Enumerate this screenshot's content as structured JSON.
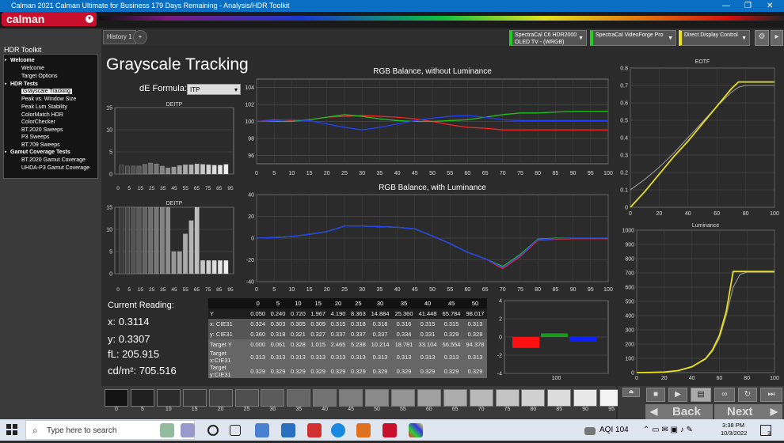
{
  "window": {
    "title": "Calman 2021 Calman Ultimate for Business 179 Days Remaining  - Analysis/HDR Toolkit",
    "minimize": "—",
    "restore": "❐",
    "close": "✕"
  },
  "app": {
    "logo": "calman"
  },
  "sidebar": {
    "title": "HDR Toolkit",
    "items": [
      {
        "label": "Welcome",
        "level": 0
      },
      {
        "label": "Welcome",
        "level": 1
      },
      {
        "label": "Target Options",
        "level": 1
      },
      {
        "label": "HDR Tests",
        "level": 0
      },
      {
        "label": "Grayscale Tracking",
        "level": 1,
        "selected": true
      },
      {
        "label": "Peak vs. Window Size",
        "level": 1
      },
      {
        "label": "Peak Lum Stability",
        "level": 1
      },
      {
        "label": "ColorMatch HDR",
        "level": 1
      },
      {
        "label": "ColorChecker",
        "level": 1
      },
      {
        "label": "BT.2020 Sweeps",
        "level": 1
      },
      {
        "label": "P3 Sweeps",
        "level": 1
      },
      {
        "label": "BT.709 Sweeps",
        "level": 1
      },
      {
        "label": "Gamut Coverage Tests",
        "level": 0
      },
      {
        "label": "BT.2020 Gamut Coverage",
        "level": 1
      },
      {
        "label": "UHDA-P3 Gamut Coverage",
        "level": 1
      }
    ]
  },
  "tabs": {
    "history": "History 1",
    "add": "+"
  },
  "devices": [
    {
      "line1": "SpectraCal C6 HDR2000",
      "line2": "OLED TV - (WRGB)",
      "color": "#22cc22"
    },
    {
      "line1": "SpectraCal VideoForge Pro",
      "line2": "",
      "color": "#22cc22"
    },
    {
      "line1": "Direct Display Control",
      "line2": "",
      "color": "#e8e020"
    }
  ],
  "page": {
    "title": "Grayscale Tracking",
    "de_label": "dE Formula:",
    "de_value": "ITP"
  },
  "readings": {
    "heading": "Current Reading:",
    "x": "x: 0.3114",
    "y": "y: 0.3307",
    "fl": "fL: 205.915",
    "cdm2": "cd/m²: 705.516"
  },
  "table": {
    "headers": [
      "",
      "0",
      "5",
      "10",
      "15",
      "20",
      "25",
      "30",
      "35",
      "40",
      "45",
      "50"
    ],
    "rows": [
      [
        "Y",
        "0.050",
        "0.240",
        "0.720",
        "1.967",
        "4.190",
        "8.363",
        "14.884",
        "25.360",
        "41.448",
        "65.784",
        "98.017"
      ],
      [
        "x: CIE31",
        "0.324",
        "0.303",
        "0.305",
        "0.309",
        "0.315",
        "0.318",
        "0.318",
        "0.316",
        "0.315",
        "0.315",
        "0.313"
      ],
      [
        "y: CIE31",
        "0.360",
        "0.318",
        "0.321",
        "0.327",
        "0.337",
        "0.337",
        "0.337",
        "0.334",
        "0.331",
        "0.329",
        "0.328"
      ],
      [
        "Target Y",
        "0.000",
        "0.061",
        "0.328",
        "1.015",
        "2.465",
        "5.238",
        "10.214",
        "18.781",
        "33.104",
        "56.554",
        "94.378"
      ],
      [
        "Target x:CIE31",
        "0.313",
        "0.313",
        "0.313",
        "0.313",
        "0.313",
        "0.313",
        "0.313",
        "0.313",
        "0.313",
        "0.313",
        "0.313"
      ],
      [
        "Target y:CIE31",
        "0.329",
        "0.329",
        "0.329",
        "0.329",
        "0.329",
        "0.329",
        "0.329",
        "0.329",
        "0.329",
        "0.329",
        "0.329"
      ]
    ]
  },
  "chart_data": [
    {
      "type": "bar",
      "title": "DEITP",
      "categories": [
        "5",
        "10",
        "15",
        "20",
        "25",
        "30",
        "35",
        "40",
        "45",
        "50",
        "55",
        "60",
        "65",
        "70",
        "75",
        "80",
        "85",
        "90",
        "95"
      ],
      "values": [
        2,
        1.8,
        1.8,
        1.8,
        2.2,
        2.5,
        2.3,
        1.8,
        1.4,
        1.6,
        1.9,
        2.1,
        2.1,
        2.3,
        2.2,
        2.1,
        2,
        2,
        2.2
      ],
      "ylim": [
        0,
        15
      ],
      "yticks": [
        0,
        5,
        10,
        15
      ],
      "xticks": [
        "0",
        "5",
        "15",
        "25",
        "35",
        "45",
        "55",
        "65",
        "75",
        "85",
        "95"
      ]
    },
    {
      "type": "bar",
      "title": "DEITP",
      "categories": [
        "5",
        "10",
        "15",
        "20",
        "25",
        "30",
        "35",
        "40",
        "45",
        "50",
        "55",
        "60",
        "65",
        "70",
        "75",
        "80",
        "85",
        "90",
        "95"
      ],
      "values": [
        15,
        15,
        15,
        15,
        15,
        15,
        15,
        15,
        15,
        5,
        5,
        9,
        12,
        15,
        3,
        3,
        3,
        3,
        3
      ],
      "ylim": [
        0,
        15
      ],
      "yticks": [
        0,
        5,
        10,
        15
      ],
      "xticks": [
        "0",
        "5",
        "15",
        "25",
        "35",
        "45",
        "55",
        "65",
        "75",
        "85",
        "95"
      ]
    },
    {
      "type": "line",
      "title": "RGB Balance, without Luminance",
      "x": [
        0,
        5,
        10,
        15,
        20,
        25,
        30,
        35,
        40,
        45,
        50,
        55,
        60,
        65,
        70,
        75,
        80,
        85,
        90,
        95,
        100
      ],
      "ylim": [
        95,
        105
      ],
      "yticks": [
        96,
        98,
        100,
        102,
        104
      ],
      "series": [
        {
          "color": "#ff2020",
          "values": [
            100,
            100.2,
            100.1,
            100.2,
            100.5,
            100.6,
            100.7,
            100.6,
            100.5,
            100.3,
            100,
            99.6,
            99.3,
            99.2,
            99,
            99,
            99,
            99,
            99,
            99,
            99
          ]
        },
        {
          "color": "#20c020",
          "values": [
            100,
            100,
            100,
            100.2,
            100.5,
            100.8,
            100.6,
            100.3,
            100.1,
            100,
            100,
            100.1,
            100.2,
            100.5,
            100.8,
            101,
            101,
            101.1,
            101.2,
            101.2,
            101.2
          ]
        },
        {
          "color": "#2040ff",
          "values": [
            100,
            100.1,
            100.2,
            100.1,
            99.7,
            99.3,
            99,
            99.3,
            99.7,
            100.1,
            100.4,
            100.6,
            100.7,
            100.5,
            100.2,
            100.1,
            100.1,
            100.1,
            100.1,
            100.1,
            100.1
          ]
        }
      ]
    },
    {
      "type": "line",
      "title": "RGB Balance, with Luminance",
      "x": [
        0,
        5,
        10,
        15,
        20,
        25,
        30,
        35,
        40,
        45,
        50,
        55,
        60,
        65,
        70,
        75,
        80,
        85,
        90,
        95,
        100
      ],
      "ylim": [
        -40,
        40
      ],
      "yticks": [
        -40,
        -20,
        0,
        20,
        40
      ],
      "series": [
        {
          "color": "#ff2020",
          "values": [
            0,
            0.5,
            1.5,
            3.5,
            6,
            11,
            11,
            10.5,
            10,
            8.5,
            2,
            -5,
            -13,
            -19,
            -28,
            -17,
            -2,
            -1,
            -0.5,
            -0.5,
            -0.5
          ]
        },
        {
          "color": "#20c020",
          "values": [
            0,
            0.5,
            1.5,
            3.5,
            6,
            11,
            11,
            10.5,
            10,
            8.5,
            2,
            -5,
            -13,
            -19,
            -26,
            -15,
            -1,
            0,
            0,
            0,
            0
          ]
        },
        {
          "color": "#2040ff",
          "values": [
            0,
            0.5,
            1.5,
            3.5,
            6,
            11,
            11,
            10.5,
            10,
            8.5,
            2,
            -5,
            -13,
            -19,
            -27,
            -16,
            -1.5,
            -0.5,
            0,
            0,
            0
          ]
        }
      ]
    },
    {
      "type": "bar",
      "title": "",
      "categories": [
        "R",
        "G",
        "B"
      ],
      "colors": [
        "#ff1010",
        "#1a9a1a",
        "#1020ff"
      ],
      "values": [
        -1.2,
        0.4,
        -0.5
      ],
      "ylim": [
        -4,
        4
      ],
      "yticks": [
        -4,
        -2,
        0,
        2,
        4
      ],
      "xlabel": "100"
    },
    {
      "type": "line",
      "title": "EOTF",
      "x": [
        0,
        10,
        20,
        30,
        40,
        50,
        60,
        70,
        75,
        80,
        100
      ],
      "ylim": [
        0,
        0.8
      ],
      "yticks": [
        0,
        0.1,
        0.2,
        0.3,
        0.4,
        0.5,
        0.6,
        0.7,
        0.8
      ],
      "xticks": [
        0,
        20,
        40,
        60,
        80,
        100
      ],
      "series": [
        {
          "color": "#e8e020",
          "values": [
            0,
            0.09,
            0.19,
            0.29,
            0.38,
            0.48,
            0.58,
            0.68,
            0.72,
            0.72,
            0.72
          ]
        },
        {
          "color": "#999999",
          "values": [
            0.1,
            0.16,
            0.23,
            0.31,
            0.4,
            0.49,
            0.58,
            0.66,
            0.69,
            0.7,
            0.7
          ]
        }
      ]
    },
    {
      "type": "line",
      "title": "Luminance",
      "x": [
        0,
        10,
        20,
        30,
        40,
        50,
        55,
        60,
        65,
        70,
        75,
        80,
        90,
        100
      ],
      "ylim": [
        0,
        1000
      ],
      "yticks": [
        0,
        100,
        200,
        300,
        400,
        500,
        600,
        700,
        800,
        900,
        1000
      ],
      "xticks": [
        0,
        20,
        40,
        60,
        80,
        100
      ],
      "series": [
        {
          "color": "#e8e020",
          "values": [
            0,
            1,
            4,
            14,
            41,
            98,
            160,
            260,
            430,
            710,
            710,
            710,
            710,
            710
          ]
        },
        {
          "color": "#999999",
          "values": [
            0,
            0.5,
            3,
            12,
            38,
            94,
            150,
            240,
            400,
            600,
            690,
            705,
            705,
            705
          ]
        }
      ]
    }
  ],
  "patches": {
    "labels": [
      "0",
      "5",
      "10",
      "15",
      "20",
      "25",
      "30",
      "35",
      "40",
      "45",
      "50",
      "55",
      "60",
      "65",
      "70",
      "75",
      "80",
      "85",
      "90",
      "95",
      "100"
    ],
    "levels": [
      0,
      5,
      10,
      15,
      20,
      25,
      30,
      35,
      40,
      45,
      50,
      55,
      60,
      65,
      70,
      75,
      80,
      85,
      90,
      95,
      100
    ],
    "selected": "100"
  },
  "controls": {
    "back": "Back",
    "next": "Next"
  },
  "taskbar": {
    "search": "Type here to search",
    "aqi": "AQI 104",
    "time": "3:38 PM",
    "date": "10/3/2022",
    "notifications": "3"
  }
}
